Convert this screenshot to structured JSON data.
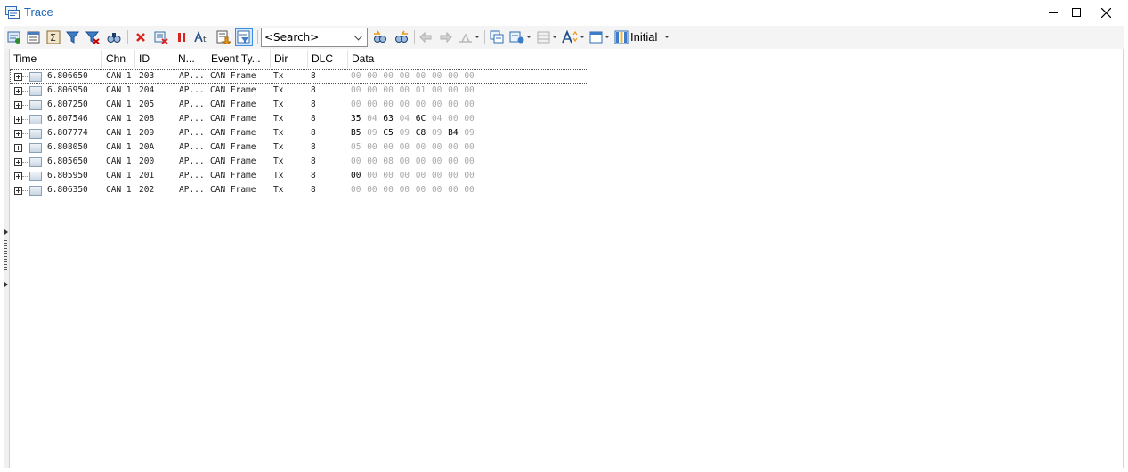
{
  "window": {
    "title": "Trace",
    "accent_color": "#1e64b4"
  },
  "toolbar": {
    "search_placeholder": "<Search>",
    "layout_label": "Initial"
  },
  "columns": [
    "Time",
    "Chn",
    "ID",
    "N...",
    "Event Ty...",
    "Dir",
    "DLC",
    "Data"
  ],
  "rows": [
    {
      "time": "6.806650",
      "chn": "CAN 1",
      "id": "203",
      "name": "AP...",
      "event": "CAN Frame",
      "dir": "Tx",
      "dlc": "8",
      "data": [
        {
          "v": "00",
          "c": "gray"
        },
        {
          "v": "00",
          "c": "gray"
        },
        {
          "v": "00",
          "c": "gray"
        },
        {
          "v": "00",
          "c": "gray"
        },
        {
          "v": "00",
          "c": "gray"
        },
        {
          "v": "00",
          "c": "gray"
        },
        {
          "v": "00",
          "c": "gray"
        },
        {
          "v": "00",
          "c": "gray"
        }
      ],
      "selected": true
    },
    {
      "time": "6.806950",
      "chn": "CAN 1",
      "id": "204",
      "name": "AP...",
      "event": "CAN Frame",
      "dir": "Tx",
      "dlc": "8",
      "data": [
        {
          "v": "00",
          "c": "gray"
        },
        {
          "v": "00",
          "c": "gray"
        },
        {
          "v": "00",
          "c": "gray"
        },
        {
          "v": "00",
          "c": "gray"
        },
        {
          "v": "01",
          "c": "gray"
        },
        {
          "v": "00",
          "c": "gray"
        },
        {
          "v": "00",
          "c": "gray"
        },
        {
          "v": "00",
          "c": "gray"
        }
      ]
    },
    {
      "time": "6.807250",
      "chn": "CAN 1",
      "id": "205",
      "name": "AP...",
      "event": "CAN Frame",
      "dir": "Tx",
      "dlc": "8",
      "data": [
        {
          "v": "00",
          "c": "gray"
        },
        {
          "v": "00",
          "c": "gray"
        },
        {
          "v": "00",
          "c": "gray"
        },
        {
          "v": "00",
          "c": "gray"
        },
        {
          "v": "00",
          "c": "gray"
        },
        {
          "v": "00",
          "c": "gray"
        },
        {
          "v": "00",
          "c": "gray"
        },
        {
          "v": "00",
          "c": "gray"
        }
      ]
    },
    {
      "time": "6.807546",
      "chn": "CAN 1",
      "id": "208",
      "name": "AP...",
      "event": "CAN Frame",
      "dir": "Tx",
      "dlc": "8",
      "data": [
        {
          "v": "35",
          "c": "dark"
        },
        {
          "v": "04",
          "c": "gray"
        },
        {
          "v": "63",
          "c": "dark"
        },
        {
          "v": "04",
          "c": "gray"
        },
        {
          "v": "6C",
          "c": "dark"
        },
        {
          "v": "04",
          "c": "gray"
        },
        {
          "v": "00",
          "c": "gray"
        },
        {
          "v": "00",
          "c": "gray"
        }
      ]
    },
    {
      "time": "6.807774",
      "chn": "CAN 1",
      "id": "209",
      "name": "AP...",
      "event": "CAN Frame",
      "dir": "Tx",
      "dlc": "8",
      "data": [
        {
          "v": "B5",
          "c": "dark"
        },
        {
          "v": "09",
          "c": "gray"
        },
        {
          "v": "C5",
          "c": "dark"
        },
        {
          "v": "09",
          "c": "gray"
        },
        {
          "v": "C8",
          "c": "dark"
        },
        {
          "v": "09",
          "c": "gray"
        },
        {
          "v": "B4",
          "c": "dark"
        },
        {
          "v": "09",
          "c": "gray"
        }
      ]
    },
    {
      "time": "6.808050",
      "chn": "CAN 1",
      "id": "20A",
      "name": "AP...",
      "event": "CAN Frame",
      "dir": "Tx",
      "dlc": "8",
      "data": [
        {
          "v": "05",
          "c": "gray"
        },
        {
          "v": "00",
          "c": "gray"
        },
        {
          "v": "00",
          "c": "gray"
        },
        {
          "v": "00",
          "c": "gray"
        },
        {
          "v": "00",
          "c": "gray"
        },
        {
          "v": "00",
          "c": "gray"
        },
        {
          "v": "00",
          "c": "gray"
        },
        {
          "v": "00",
          "c": "gray"
        }
      ]
    },
    {
      "time": "6.805650",
      "chn": "CAN 1",
      "id": "200",
      "name": "AP...",
      "event": "CAN Frame",
      "dir": "Tx",
      "dlc": "8",
      "data": [
        {
          "v": "00",
          "c": "gray"
        },
        {
          "v": "00",
          "c": "gray"
        },
        {
          "v": "08",
          "c": "gray"
        },
        {
          "v": "00",
          "c": "gray"
        },
        {
          "v": "00",
          "c": "gray"
        },
        {
          "v": "00",
          "c": "gray"
        },
        {
          "v": "00",
          "c": "gray"
        },
        {
          "v": "00",
          "c": "gray"
        }
      ]
    },
    {
      "time": "6.805950",
      "chn": "CAN 1",
      "id": "201",
      "name": "AP...",
      "event": "CAN Frame",
      "dir": "Tx",
      "dlc": "8",
      "data": [
        {
          "v": "00",
          "c": "dark"
        },
        {
          "v": "00",
          "c": "gray"
        },
        {
          "v": "00",
          "c": "gray"
        },
        {
          "v": "00",
          "c": "gray"
        },
        {
          "v": "00",
          "c": "gray"
        },
        {
          "v": "00",
          "c": "gray"
        },
        {
          "v": "00",
          "c": "gray"
        },
        {
          "v": "00",
          "c": "gray"
        }
      ]
    },
    {
      "time": "6.806350",
      "chn": "CAN 1",
      "id": "202",
      "name": "AP...",
      "event": "CAN Frame",
      "dir": "Tx",
      "dlc": "8",
      "data": [
        {
          "v": "00",
          "c": "gray"
        },
        {
          "v": "00",
          "c": "gray"
        },
        {
          "v": "00",
          "c": "gray"
        },
        {
          "v": "00",
          "c": "gray"
        },
        {
          "v": "00",
          "c": "gray"
        },
        {
          "v": "00",
          "c": "gray"
        },
        {
          "v": "00",
          "c": "gray"
        },
        {
          "v": "00",
          "c": "gray"
        }
      ]
    }
  ]
}
